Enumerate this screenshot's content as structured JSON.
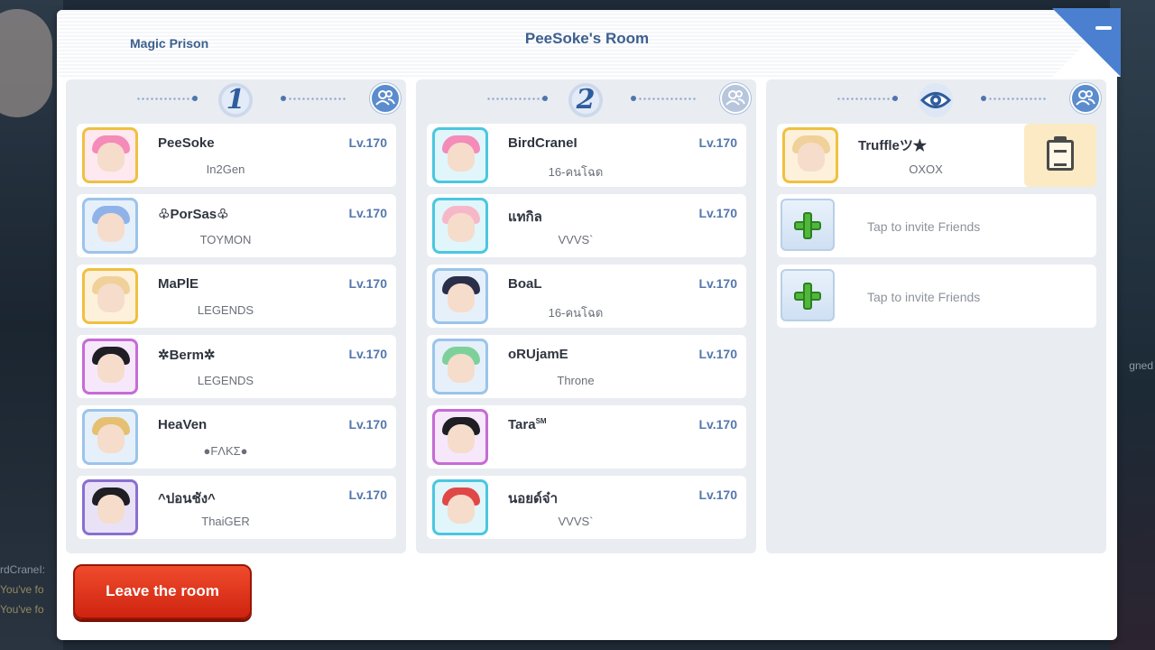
{
  "header": {
    "location": "Magic Prison",
    "title": "PeeSoke's Room"
  },
  "teams": [
    {
      "label": "1",
      "players": [
        {
          "name": "PeeSoke",
          "level": "Lv.170",
          "guild": "In2Gen",
          "frame": "#f0c040",
          "hair": "#f48bb8"
        },
        {
          "name": "♧PorSas♧",
          "level": "Lv.170",
          "guild": "TOYMON",
          "frame": "#9cc4ea",
          "hair": "#8fb3e8"
        },
        {
          "name": "MaPlE",
          "level": "Lv.170",
          "guild": "LEGENDS",
          "frame": "#f0c040",
          "hair": "#f0d19a"
        },
        {
          "name": "✲Berm✲",
          "level": "Lv.170",
          "guild": "LEGENDS",
          "frame": "#c66bd6",
          "hair": "#1e1e24"
        },
        {
          "name": "HeaVen",
          "level": "Lv.170",
          "guild": "●FΛKΣ●",
          "frame": "#9cc4ea",
          "hair": "#e4c070"
        },
        {
          "name": "^ปอนชัง^",
          "level": "Lv.170",
          "guild": "ThaiGER",
          "frame": "#8a6fd0",
          "hair": "#1e1e24"
        }
      ]
    },
    {
      "label": "2",
      "players": [
        {
          "name": "BirdCraneI",
          "level": "Lv.170",
          "guild": "16-คนโฉด",
          "frame": "#4cc6e0",
          "hair": "#f48bb8"
        },
        {
          "name": "แทกิล",
          "level": "Lv.170",
          "guild": "VVVS`",
          "frame": "#4cc6e0",
          "hair": "#f6b8c8"
        },
        {
          "name": "BoaL",
          "level": "Lv.170",
          "guild": "16-คนโฉด",
          "frame": "#9cc4ea",
          "hair": "#2a2e48"
        },
        {
          "name": "oRUjamE",
          "level": "Lv.170",
          "guild": "Throne",
          "frame": "#9cc4ea",
          "hair": "#7ed09a"
        },
        {
          "name": "Tara",
          "name_sup": "SM",
          "level": "Lv.170",
          "guild": "",
          "frame": "#c66bd6",
          "hair": "#1e1e24"
        },
        {
          "name": "นอยด์จ๋า",
          "level": "Lv.170",
          "guild": "VVVS`",
          "frame": "#4cc6e0",
          "hair": "#e04848"
        }
      ]
    }
  ],
  "spectators": {
    "players": [
      {
        "name": "Truffleツ★",
        "guild": "OXOX",
        "frame": "#f0c040",
        "hair": "#f0d19a"
      }
    ],
    "invite_slots": [
      {
        "label": "Tap to invite Friends"
      },
      {
        "label": "Tap to invite Friends"
      }
    ]
  },
  "actions": {
    "leave_label": "Leave the room"
  },
  "background": {
    "chat_lines": [
      "rdCraneI:",
      "You've fo",
      "You've fo"
    ],
    "side_text": "gned"
  },
  "colors": {
    "title": "#3c5f8e",
    "level": "#5477ad",
    "leave_button": "#df3318",
    "column_bg": "#e9ecf1",
    "accent_blue": "#4a80cf"
  }
}
